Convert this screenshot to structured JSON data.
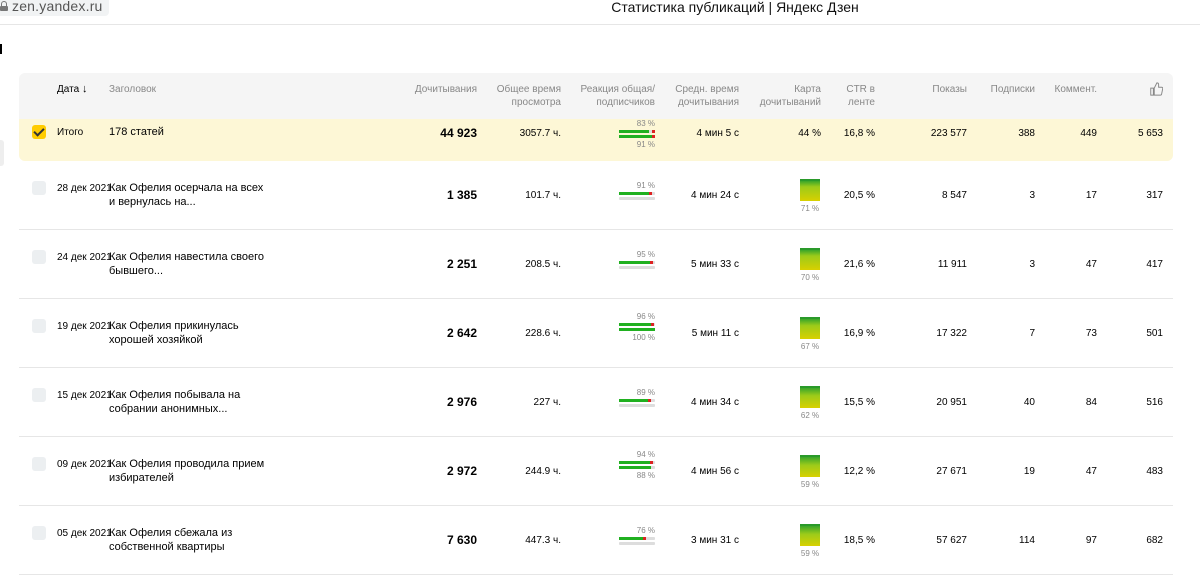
{
  "browser": {
    "url": "zen.yandex.ru",
    "title": "Статистика публикаций | Яндекс Дзен"
  },
  "colors": {
    "accent": "#ffcc00",
    "total_bg": "#fdf7d6",
    "green": "#20b020",
    "red": "#d22222"
  },
  "table": {
    "headers": {
      "date": "Дата",
      "sort_arrow": "↓",
      "title": "Заголовок",
      "reads": "Дочитывания",
      "view_time": "Общее время просмотра",
      "reaction": "Реакция общая/ подписчиков",
      "avg_time": "Средн. время дочитывания",
      "heatmap": "Карта дочитываний",
      "ctr": "CTR в ленте",
      "views": "Показы",
      "subs": "Подписки",
      "comments": "Коммент.",
      "likes_icon": "thumbs-up-icon"
    },
    "total": {
      "label": "Итого",
      "title": "178 статей",
      "reads": "44 923",
      "view_time": "3057.7 ч.",
      "reaction_all": "83 %",
      "reaction_subs": "91 %",
      "reaction_all_value": 0.83,
      "reaction_subs_value": 0.91,
      "avg_time": "4 мин 5 с",
      "heatmap": "44 %",
      "ctr": "16,8 %",
      "views": "223 577",
      "subs": "388",
      "comments": "449",
      "likes": "5 653"
    },
    "rows": [
      {
        "date": "28 дек 2021",
        "title": "Как Офелия осерчала на всех и вернулась на...",
        "reads": "1 385",
        "view_time": "101.7 ч.",
        "reaction_all": "91 %",
        "reaction_subs": "",
        "reaction_all_value": 0.91,
        "reaction_subs_value": 0,
        "avg_time": "4 мин 24 с",
        "heatmap": "71 %",
        "heatmap_value": 0.71,
        "ctr": "20,5 %",
        "views": "8 547",
        "subs": "3",
        "comments": "17",
        "likes": "317"
      },
      {
        "date": "24 дек 2021",
        "title": "Как Офелия навестила своего бывшего...",
        "reads": "2 251",
        "view_time": "208.5 ч.",
        "reaction_all": "95 %",
        "reaction_subs": "",
        "reaction_all_value": 0.95,
        "reaction_subs_value": 0,
        "avg_time": "5 мин 33 с",
        "heatmap": "70 %",
        "heatmap_value": 0.7,
        "ctr": "21,6 %",
        "views": "11 911",
        "subs": "3",
        "comments": "47",
        "likes": "417"
      },
      {
        "date": "19 дек 2021",
        "title": "Как Офелия прикинулась хорошей хозяйкой",
        "reads": "2 642",
        "view_time": "228.6 ч.",
        "reaction_all": "96 %",
        "reaction_subs": "100 %",
        "reaction_all_value": 0.96,
        "reaction_subs_value": 1.0,
        "avg_time": "5 мин 11 с",
        "heatmap": "67 %",
        "heatmap_value": 0.67,
        "ctr": "16,9 %",
        "views": "17 322",
        "subs": "7",
        "comments": "73",
        "likes": "501"
      },
      {
        "date": "15 дек 2021",
        "title": "Как Офелия побывала на собрании анонимных...",
        "reads": "2 976",
        "view_time": "227 ч.",
        "reaction_all": "89 %",
        "reaction_subs": "",
        "reaction_all_value": 0.89,
        "reaction_subs_value": 0,
        "avg_time": "4 мин 34 с",
        "heatmap": "62 %",
        "heatmap_value": 0.62,
        "ctr": "15,5 %",
        "views": "20 951",
        "subs": "40",
        "comments": "84",
        "likes": "516"
      },
      {
        "date": "09 дек 2021",
        "title": "Как Офелия проводила прием избирателей",
        "reads": "2 972",
        "view_time": "244.9 ч.",
        "reaction_all": "94 %",
        "reaction_subs": "88 %",
        "reaction_all_value": 0.94,
        "reaction_subs_value": 0.88,
        "avg_time": "4 мин 56 с",
        "heatmap": "59 %",
        "heatmap_value": 0.59,
        "ctr": "12,2 %",
        "views": "27 671",
        "subs": "19",
        "comments": "47",
        "likes": "483"
      },
      {
        "date": "05 дек 2021",
        "title": "Как Офелия сбежала из собственной квартиры",
        "reads": "7 630",
        "view_time": "447.3 ч.",
        "reaction_all": "76 %",
        "reaction_subs": "",
        "reaction_all_value": 0.76,
        "reaction_subs_value": 0,
        "avg_time": "3 мин 31 с",
        "heatmap": "59 %",
        "heatmap_value": 0.59,
        "ctr": "18,5 %",
        "views": "57 627",
        "subs": "114",
        "comments": "97",
        "likes": "682"
      }
    ]
  }
}
